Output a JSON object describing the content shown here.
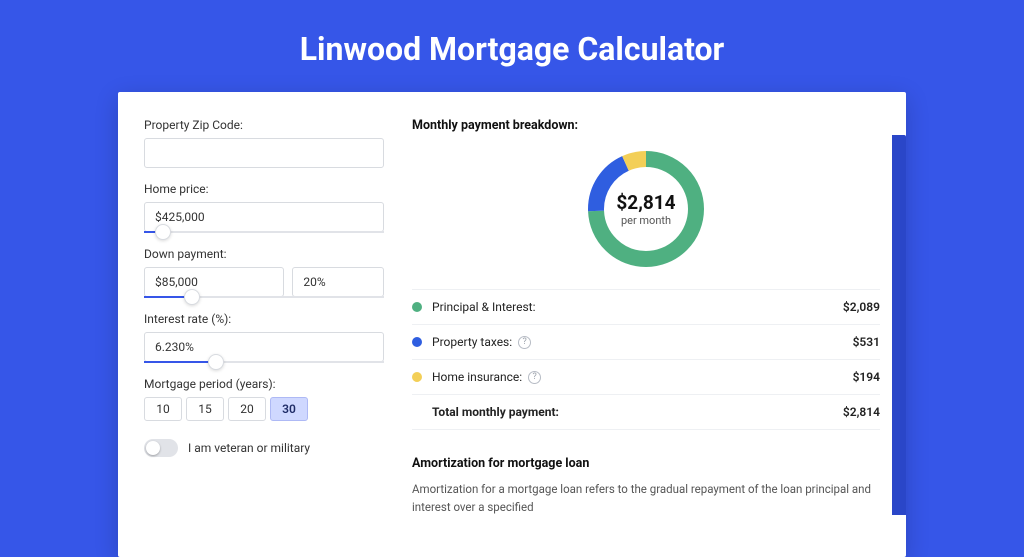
{
  "hero": {
    "title": "Linwood Mortgage Calculator"
  },
  "form": {
    "zip": {
      "label": "Property Zip Code:",
      "value": ""
    },
    "price": {
      "label": "Home price:",
      "value": "$425,000",
      "slider_pct": 8
    },
    "down": {
      "label": "Down payment:",
      "amount": "$85,000",
      "pct": "20%",
      "slider_pct": 20
    },
    "rate": {
      "label": "Interest rate (%):",
      "value": "6.230%",
      "slider_pct": 30
    },
    "term": {
      "label": "Mortgage period (years):",
      "options": [
        "10",
        "15",
        "20",
        "30"
      ],
      "selected": "30"
    },
    "vet": {
      "label": "I am veteran or military",
      "on": false
    }
  },
  "breakdown": {
    "title": "Monthly payment breakdown:",
    "total_amount": "$2,814",
    "per_month": "per month",
    "items": [
      {
        "label": "Principal & Interest:",
        "value": "$2,089",
        "color": "#4fb081",
        "info": false
      },
      {
        "label": "Property taxes:",
        "value": "$531",
        "color": "#2f5ee0",
        "info": true
      },
      {
        "label": "Home insurance:",
        "value": "$194",
        "color": "#f3cf57",
        "info": true
      }
    ],
    "total_row": {
      "label": "Total monthly payment:",
      "value": "$2,814"
    }
  },
  "amort": {
    "title": "Amortization for mortgage loan",
    "body": "Amortization for a mortgage loan refers to the gradual repayment of the loan principal and interest over a specified"
  },
  "chart_data": {
    "type": "pie",
    "title": "Monthly payment breakdown",
    "categories": [
      "Principal & Interest",
      "Property taxes",
      "Home insurance"
    ],
    "values": [
      2089,
      531,
      194
    ],
    "colors": [
      "#4fb081",
      "#2f5ee0",
      "#f3cf57"
    ],
    "center_label": "$2,814 per month"
  }
}
